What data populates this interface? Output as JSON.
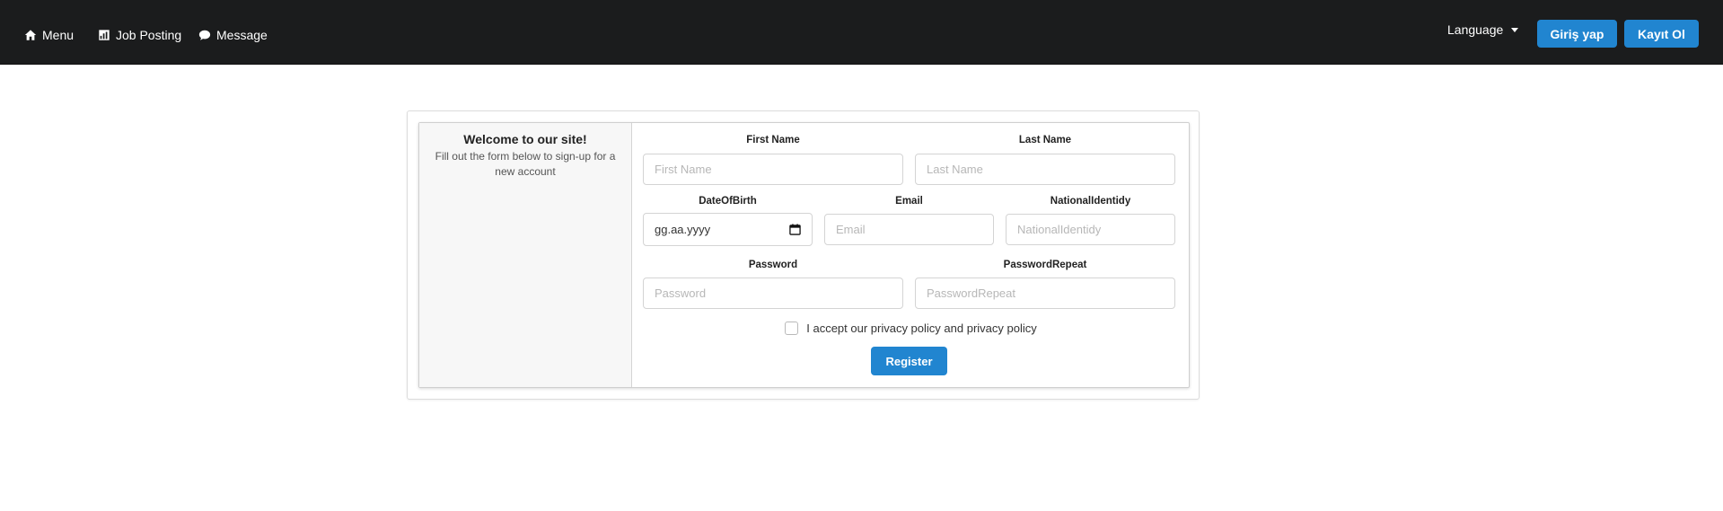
{
  "nav": {
    "menu_label": "Menu",
    "job_posting_label": "Job Posting",
    "message_label": "Message",
    "language_label": "Language",
    "login_label": "Giriş yap",
    "register_label": "Kayıt Ol"
  },
  "welcome": {
    "title": "Welcome to our site!",
    "subtitle": "Fill out the form below to sign-up for a new account"
  },
  "form": {
    "first_name": {
      "label": "First Name",
      "placeholder": "First Name"
    },
    "last_name": {
      "label": "Last Name",
      "placeholder": "Last Name"
    },
    "date_of_birth": {
      "label": "DateOfBirth",
      "value": "gg.aa.yyyy"
    },
    "email": {
      "label": "Email",
      "placeholder": "Email"
    },
    "national_identity": {
      "label": "NationalIdentidy",
      "placeholder": "NationalIdentidy"
    },
    "password": {
      "label": "Password",
      "placeholder": "Password"
    },
    "password_repeat": {
      "label": "PasswordRepeat",
      "placeholder": "PasswordRepeat"
    },
    "privacy_text": "I accept our privacy policy and privacy policy",
    "submit_label": "Register"
  },
  "colors": {
    "navbar": "#1b1c1d",
    "primary": "#2185d0"
  },
  "icons": {
    "menu": "home-icon",
    "job_posting": "chart-icon",
    "message": "chat-bubble-icon",
    "date": "calendar-icon"
  }
}
